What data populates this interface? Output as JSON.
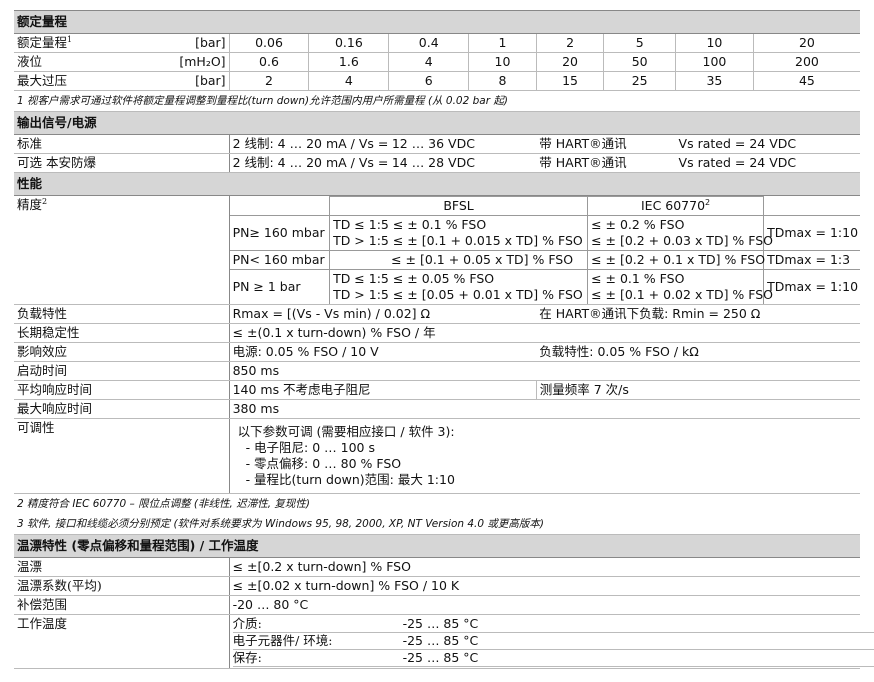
{
  "rated": {
    "title": "额定量程",
    "rows": [
      {
        "label": "额定量程",
        "sup": "1",
        "unit": "[bar]",
        "values": [
          "0.06",
          "0.16",
          "0.4",
          "1",
          "2",
          "5",
          "10",
          "20"
        ]
      },
      {
        "label": "液位",
        "unit": "[mH₂O]",
        "values": [
          "0.6",
          "1.6",
          "4",
          "10",
          "20",
          "50",
          "100",
          "200"
        ]
      },
      {
        "label": "最大过压",
        "unit": "[bar]",
        "values": [
          "2",
          "4",
          "6",
          "8",
          "15",
          "25",
          "35",
          "45"
        ]
      }
    ],
    "note": "1 视客户需求可通过软件将额定量程调整到量程比(turn down)允许范围内用户所需量程 (从 0.02 bar 起)"
  },
  "output": {
    "title": "输出信号/电源",
    "rows": [
      {
        "label": "标准",
        "a": "2 线制: 4 … 20 mA / Vs =",
        "b": "12 … 36 VDC",
        "c": "带 HART®通讯",
        "d": "Vs rated = 24 VDC"
      },
      {
        "label": "可选 本安防爆",
        "a": "2 线制: 4 … 20 mA / Vs =",
        "b": "14 … 28 VDC",
        "c": "带 HART®通讯",
        "d": "Vs rated = 24 VDC"
      }
    ]
  },
  "performance": {
    "title": "性能",
    "accuracy_label": "精度",
    "accuracy_sup": "2",
    "bfsl": "BFSL",
    "iec": "IEC 60770",
    "iec_sup": "2",
    "acc_rows": [
      {
        "cond": "PN≥ 160 mbar",
        "b1": "TD ≤ 1:5   ≤ ± 0.1 % FSO",
        "b2": "TD > 1:5   ≤ ± [0.1 + 0.015 x TD] % FSO",
        "i1": "≤ ± 0.2 % FSO",
        "i2": "≤ ± [0.2 + 0.03 x TD] % FSO",
        "td": "TDmax = 1:10"
      },
      {
        "cond": "PN< 160 mbar",
        "b1": "≤ ± [0.1 + 0.05 x TD] % FSO",
        "b2": "",
        "i1": "≤ ± [0.2 + 0.1 x TD] % FSO",
        "i2": "",
        "td": "TDmax = 1:3"
      },
      {
        "cond": "PN ≥ 1 bar",
        "b1": "TD ≤ 1:5   ≤ ± 0.05 % FSO",
        "b2": "TD > 1:5   ≤ ± [0.05 + 0.01 x TD] % FSO",
        "i1": "≤ ± 0.1 % FSO",
        "i2": "≤ ± [0.1 + 0.02 x TD] % FSO",
        "td": "TDmax = 1:10"
      }
    ],
    "rows": [
      {
        "label": "负载特性",
        "a": "Rmax = [(Vs - Vs min) / 0.02] Ω",
        "b": "在 HART®通讯下负载: Rmin = 250 Ω"
      },
      {
        "label": "长期稳定性",
        "a": "≤ ±(0.1 x turn-down) % FSO / 年",
        "b": ""
      },
      {
        "label": "影响效应",
        "a": "电源: 0.05 % FSO / 10 V",
        "b": "负载特性: 0.05 % FSO / kΩ"
      },
      {
        "label": "启动时间",
        "a": "850 ms",
        "b": ""
      },
      {
        "label": "平均响应时间",
        "a": "140 ms  不考虑电子阻尼",
        "b": "测量频率 7 次/s"
      },
      {
        "label": "最大响应时间",
        "a": "380 ms",
        "b": ""
      }
    ],
    "adjust_label": "可调性",
    "adjust_lines": [
      "以下参数可调 (需要相应接口 / 软件 3):",
      "- 电子阻尼:  0 … 100 s",
      "- 零点偏移:  0 … 80 % FSO",
      "- 量程比(turn down)范围:  最大 1:10"
    ],
    "note2": "2 精度符合 IEC 60770 – 限位点调整 (非线性, 迟滞性, 复现性)",
    "note3": "3 软件, 接口和线缆必须分别预定 (软件对系统要求为 Windows 95, 98, 2000, XP, NT Version 4.0 或更高版本)"
  },
  "temp": {
    "title": "温漂特性 (零点偏移和量程范围) / 工作温度",
    "rows": [
      {
        "label": "温漂",
        "a": "≤ ±[0.2 x turn-down] % FSO"
      },
      {
        "label": "温漂系数(平均)",
        "a": "≤ ±[0.02 x turn-down] % FSO / 10 K"
      },
      {
        "label": "补偿范围",
        "a": "-20 … 80 °C"
      }
    ],
    "work_label": "工作温度",
    "work_rows": [
      {
        "k": "介质:",
        "v": "-25 … 85 °C"
      },
      {
        "k": "电子元器件/ 环境:",
        "v": "-25 … 85 °C"
      },
      {
        "k": "保存:",
        "v": "-25 … 85 °C"
      }
    ]
  }
}
